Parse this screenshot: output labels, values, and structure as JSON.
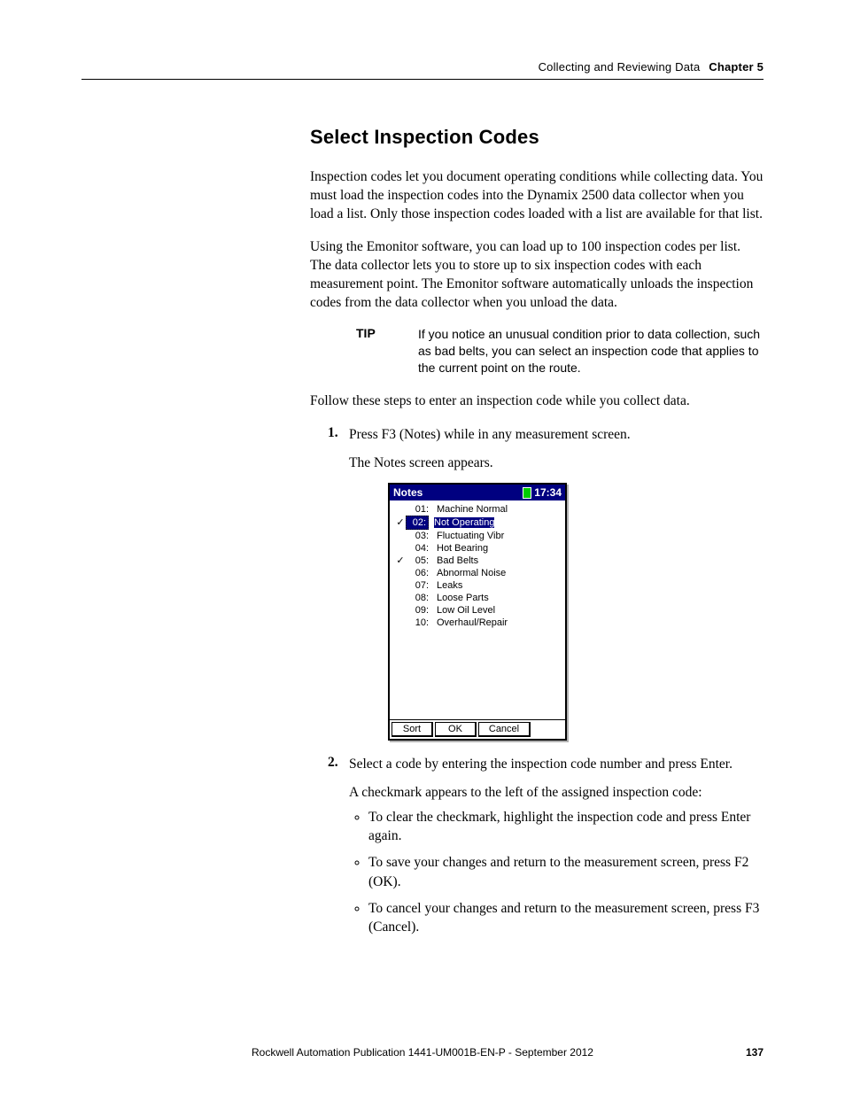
{
  "header": {
    "section": "Collecting and Reviewing Data",
    "chapter": "Chapter 5"
  },
  "title": "Select Inspection Codes",
  "para1": "Inspection codes let you document operating conditions while collecting data. You must load the inspection codes into the Dynamix 2500 data collector when you load a list. Only those inspection codes loaded with a list are available for that list.",
  "para2": "Using the Emonitor software, you can load up to 100 inspection codes per list. The data collector lets you to store up to six inspection codes with each measurement point. The Emonitor software automatically unloads the inspection codes from the data collector when you unload the data.",
  "tip": {
    "label": "TIP",
    "text": "If you notice an unusual condition prior to data collection, such as bad belts, you can select an inspection code that applies to the current point on the route."
  },
  "para3": "Follow these steps to enter an inspection code while you collect data.",
  "steps": {
    "s1": {
      "num": "1.",
      "text": "Press F3 (Notes) while in any measurement screen.",
      "sub": "The Notes screen appears."
    },
    "s2": {
      "num": "2.",
      "text": "Select a code by entering the inspection code number and press Enter.",
      "sub": "A checkmark appears to the left of the assigned inspection code:",
      "bullets": {
        "b1": "To clear the checkmark, highlight the inspection code and press Enter again.",
        "b2": "To save your changes and return to the measurement screen, press F2 (OK).",
        "b3": "To cancel your changes and return to the measurement screen, press F3 (Cancel)."
      }
    }
  },
  "device": {
    "title": "Notes",
    "time": "17:34",
    "rows": {
      "r1": {
        "check": "",
        "num": "01:",
        "label": "Machine Normal"
      },
      "r2": {
        "check": "✓",
        "num": "02:",
        "label": "Not Operating"
      },
      "r3": {
        "check": "",
        "num": "03:",
        "label": "Fluctuating Vibr"
      },
      "r4": {
        "check": "",
        "num": "04:",
        "label": "Hot Bearing"
      },
      "r5": {
        "check": "✓",
        "num": "05:",
        "label": "Bad Belts"
      },
      "r6": {
        "check": "",
        "num": "06:",
        "label": "Abnormal Noise"
      },
      "r7": {
        "check": "",
        "num": "07:",
        "label": "Leaks"
      },
      "r8": {
        "check": "",
        "num": "08:",
        "label": "Loose Parts"
      },
      "r9": {
        "check": "",
        "num": "09:",
        "label": "Low Oil Level"
      },
      "r10": {
        "check": "",
        "num": "10:",
        "label": "Overhaul/Repair"
      }
    },
    "buttons": {
      "sort": "Sort",
      "ok": "OK",
      "cancel": "Cancel"
    }
  },
  "footer": {
    "pub": "Rockwell Automation Publication 1441-UM001B-EN-P - September 2012",
    "page": "137"
  }
}
